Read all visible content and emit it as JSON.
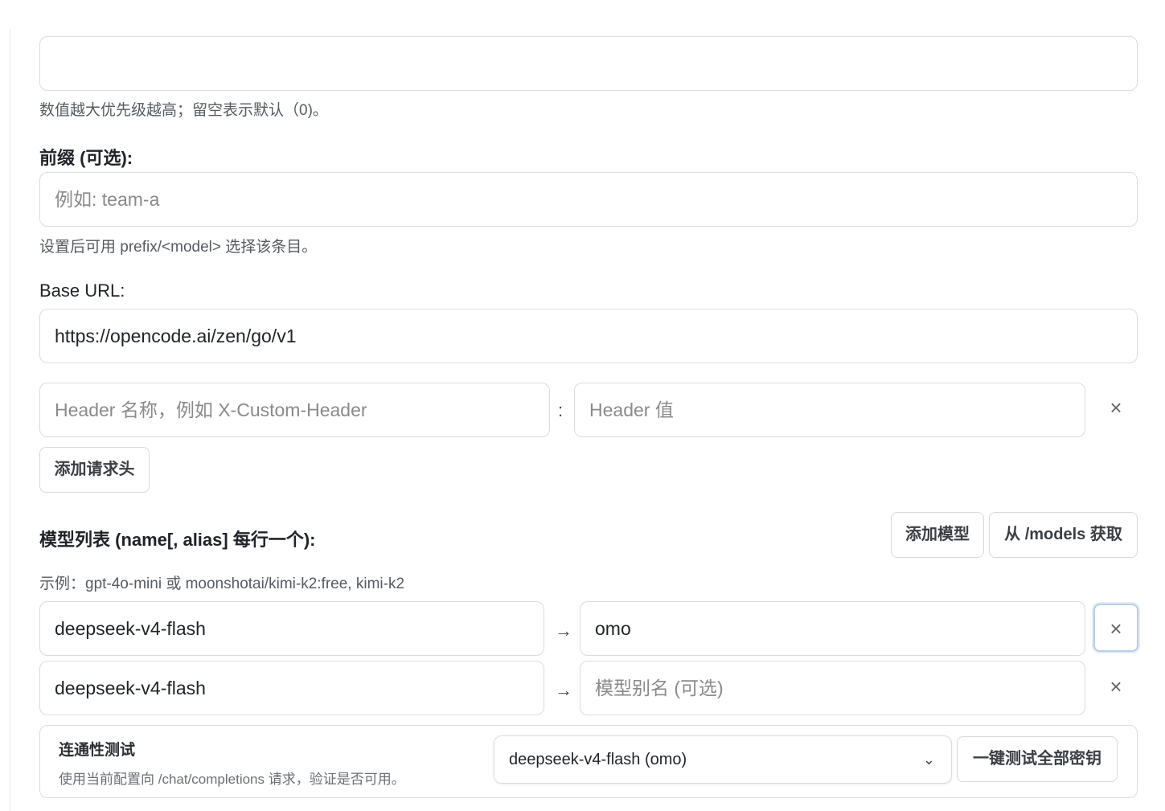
{
  "priority": {
    "value": "",
    "hint": "数值越大优先级越高；留空表示默认（0)。"
  },
  "prefix": {
    "label": "前缀 (可选):",
    "placeholder": "例如: team-a",
    "hint": "设置后可用 prefix/<model> 选择该条目。"
  },
  "base_url": {
    "label": "Base URL:",
    "value": "https://opencode.ai/zen/go/v1"
  },
  "headers": {
    "name_placeholder": "Header 名称，例如 X-Custom-Header",
    "separator": ":",
    "value_placeholder": "Header 值",
    "remove_glyph": "×",
    "add_label": "添加请求头"
  },
  "models": {
    "label": "模型列表 (name[, alias] 每行一个):",
    "add_label": "添加模型",
    "fetch_label": "从 /models 获取",
    "example": "示例：gpt-4o-mini 或 moonshotai/kimi-k2:free, kimi-k2",
    "arrow": "→",
    "remove_glyph": "×",
    "alias_placeholder": "模型别名 (可选)",
    "rows": [
      {
        "name": "deepseek-v4-flash",
        "alias": "omo"
      },
      {
        "name": "deepseek-v4-flash",
        "alias": ""
      }
    ]
  },
  "connectivity": {
    "title": "连通性测试",
    "description": "使用当前配置向 /chat/completions 请求，验证是否可用。",
    "selected_model": "deepseek-v4-flash (omo)",
    "chevron": "⌄",
    "test_all_label": "一键测试全部密钥"
  }
}
